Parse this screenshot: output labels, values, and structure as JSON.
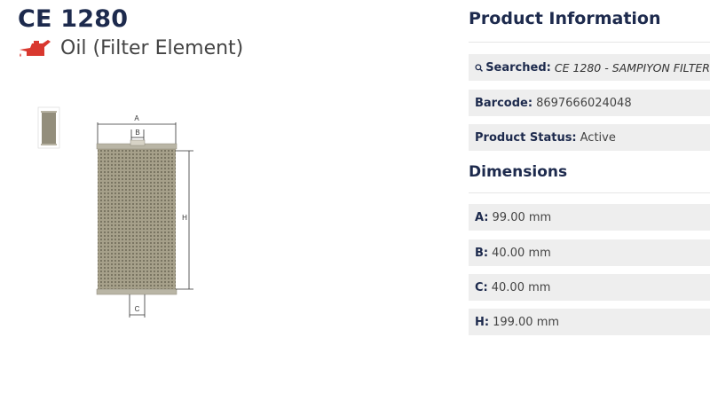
{
  "product": {
    "code": "CE 1280",
    "category": "Oil (Filter Element)"
  },
  "info": {
    "title": "Product Information",
    "searched_label": "Searched:",
    "searched_value": "CE 1280 - SAMPIYON FILTER",
    "barcode_label": "Barcode:",
    "barcode_value": "8697666024048",
    "status_label": "Product Status:",
    "status_value": "Active"
  },
  "dimensions": {
    "title": "Dimensions",
    "items": [
      {
        "label": "A:",
        "value": "99.00 mm"
      },
      {
        "label": "B:",
        "value": "40.00 mm"
      },
      {
        "label": "C:",
        "value": "40.00 mm"
      },
      {
        "label": "H:",
        "value": "199.00 mm"
      }
    ]
  },
  "diagram_labels": {
    "a": "A",
    "b": "B",
    "c": "C",
    "h": "H"
  },
  "colors": {
    "accent": "#d9382f",
    "heading": "#1d2a4d",
    "row_bg": "#eeeeee"
  },
  "icons": {
    "category": "oil-can-icon",
    "search": "search-icon"
  }
}
